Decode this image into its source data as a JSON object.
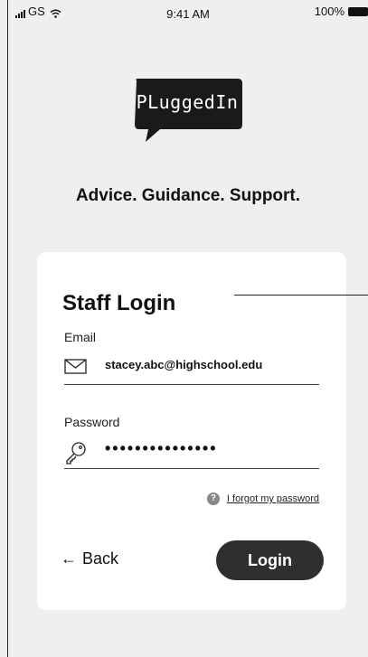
{
  "status_bar": {
    "carrier": "GS",
    "time": "9:41 AM",
    "battery": "100%"
  },
  "brand": {
    "logo_text": "PLuggedIn"
  },
  "tagline": "Advice. Guidance. Support.",
  "login": {
    "title": "Staff Login",
    "email_label": "Email",
    "email_value": "stacey.abc@highschool.edu",
    "password_label": "Password",
    "password_value": "•••••••••••••••",
    "forgot_link": "I forgot my password",
    "help_glyph": "?",
    "back_arrow": "←",
    "back_label": "Back",
    "login_button": "Login"
  },
  "icons": [
    "signal-icon",
    "wifi-icon",
    "battery-icon",
    "envelope-icon",
    "key-icon",
    "help-icon",
    "back-arrow-icon"
  ],
  "colors": {
    "background": "#efefef",
    "card": "#ffffff",
    "button": "#2f2f2f",
    "logo": "#1a1a1a"
  }
}
